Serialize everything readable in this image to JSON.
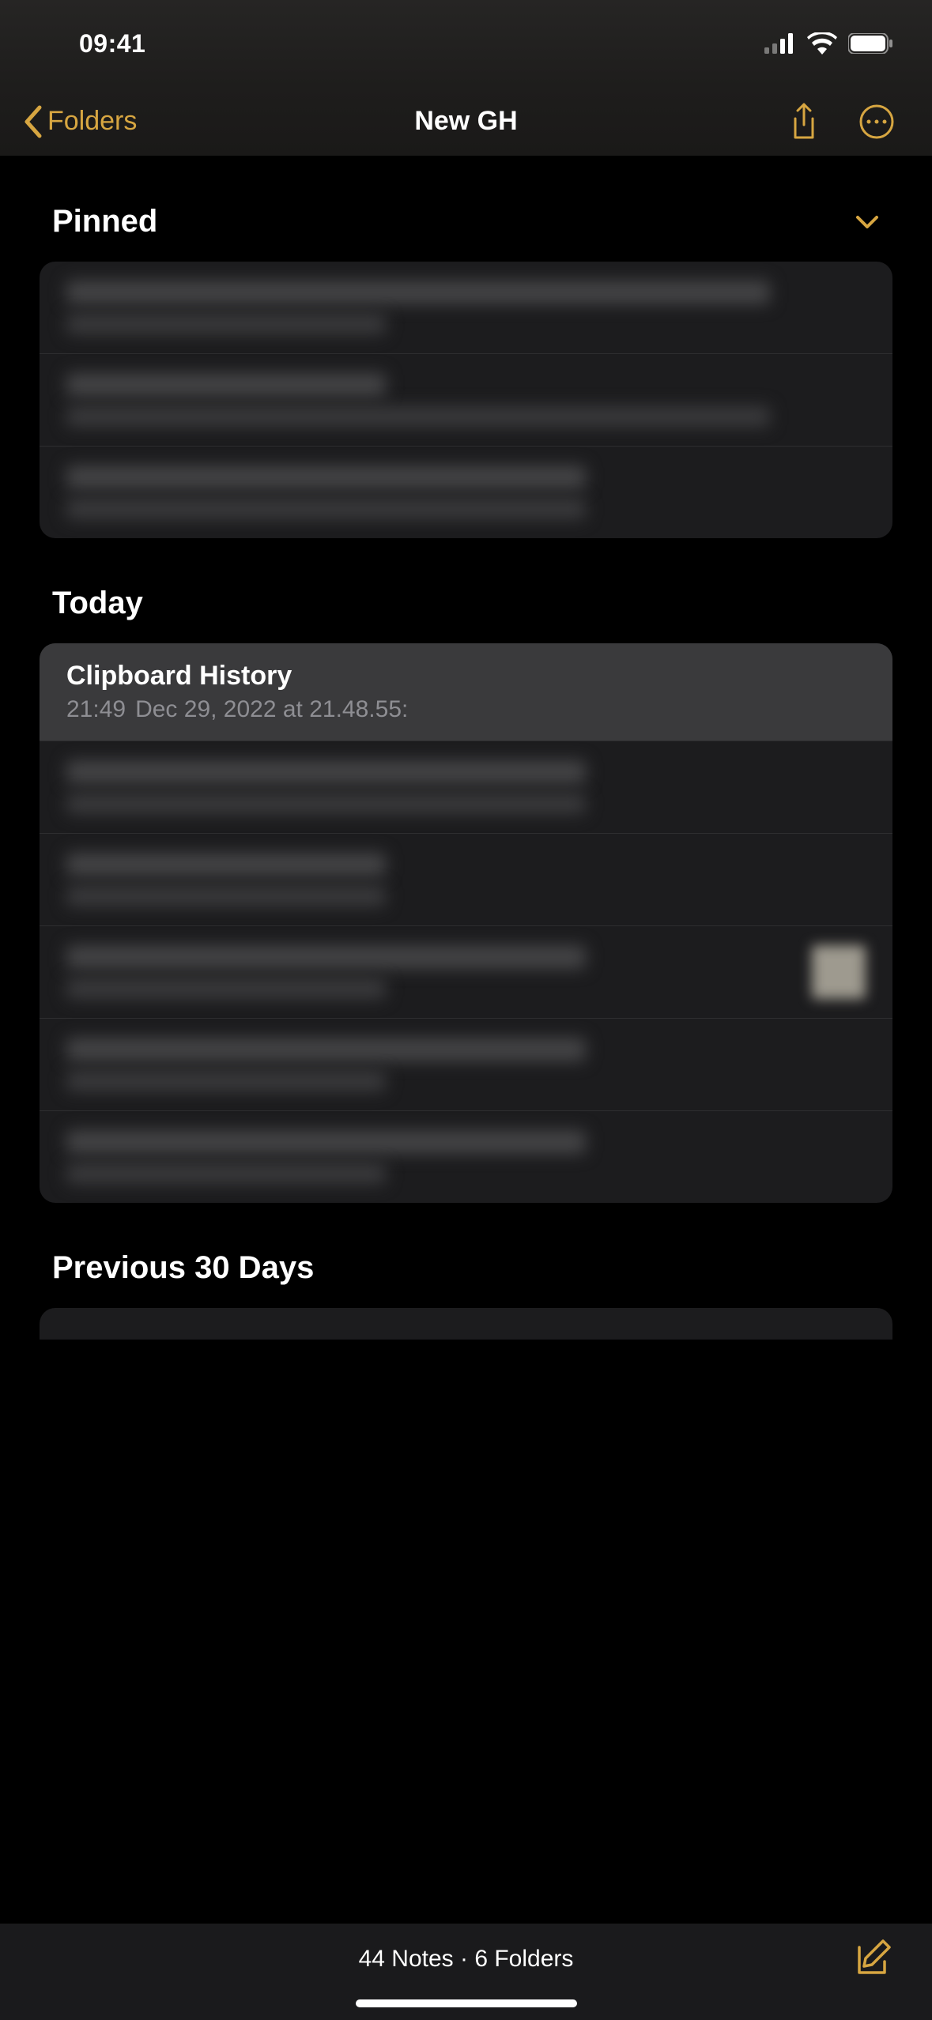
{
  "status": {
    "time": "09:41"
  },
  "nav": {
    "back_label": "Folders",
    "title": "New GH"
  },
  "sections": {
    "pinned": {
      "title": "Pinned"
    },
    "today": {
      "title": "Today",
      "notes": [
        {
          "title": "Clipboard History",
          "time": "21:49",
          "preview": "Dec 29, 2022 at 21.48.55:"
        }
      ]
    },
    "previous30": {
      "title": "Previous 30 Days"
    }
  },
  "toolbar": {
    "summary": "44 Notes · 6 Folders"
  },
  "accent_color": "#d7a641"
}
